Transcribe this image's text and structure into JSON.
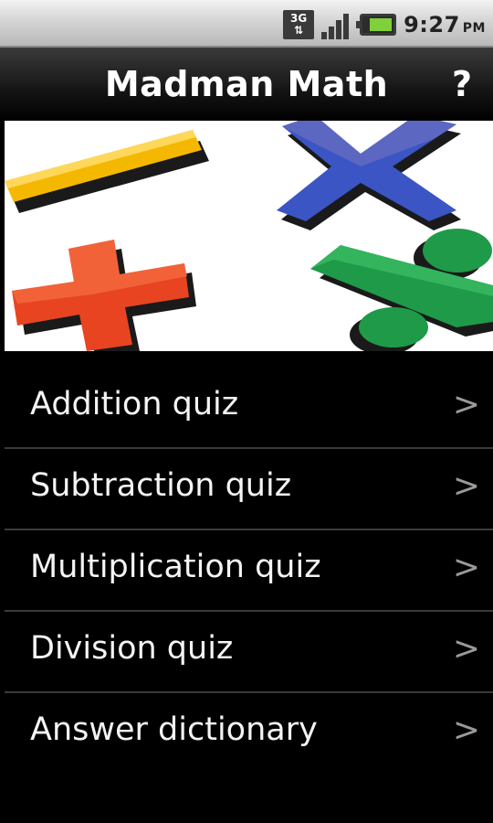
{
  "status_bar": {
    "network_label_top": "3G",
    "network_label_bottom": "⇅",
    "time": "9:27",
    "ampm": "PM",
    "icons": [
      "network-3g-icon",
      "signal-icon",
      "battery-icon"
    ]
  },
  "header": {
    "title": "Madman Math",
    "help_label": "?"
  },
  "banner": {
    "icons": [
      "minus-icon",
      "times-icon",
      "plus-icon",
      "divide-icon"
    ],
    "colors": {
      "minus": "#f5b800",
      "times": "#3b55c4",
      "plus": "#e84422",
      "divide": "#1f9a48"
    }
  },
  "menu": {
    "items": [
      {
        "label": "Addition quiz",
        "chevron": ">"
      },
      {
        "label": "Subtraction quiz",
        "chevron": ">"
      },
      {
        "label": "Multiplication quiz",
        "chevron": ">"
      },
      {
        "label": "Division quiz",
        "chevron": ">"
      },
      {
        "label": "Answer dictionary",
        "chevron": ">"
      }
    ]
  }
}
